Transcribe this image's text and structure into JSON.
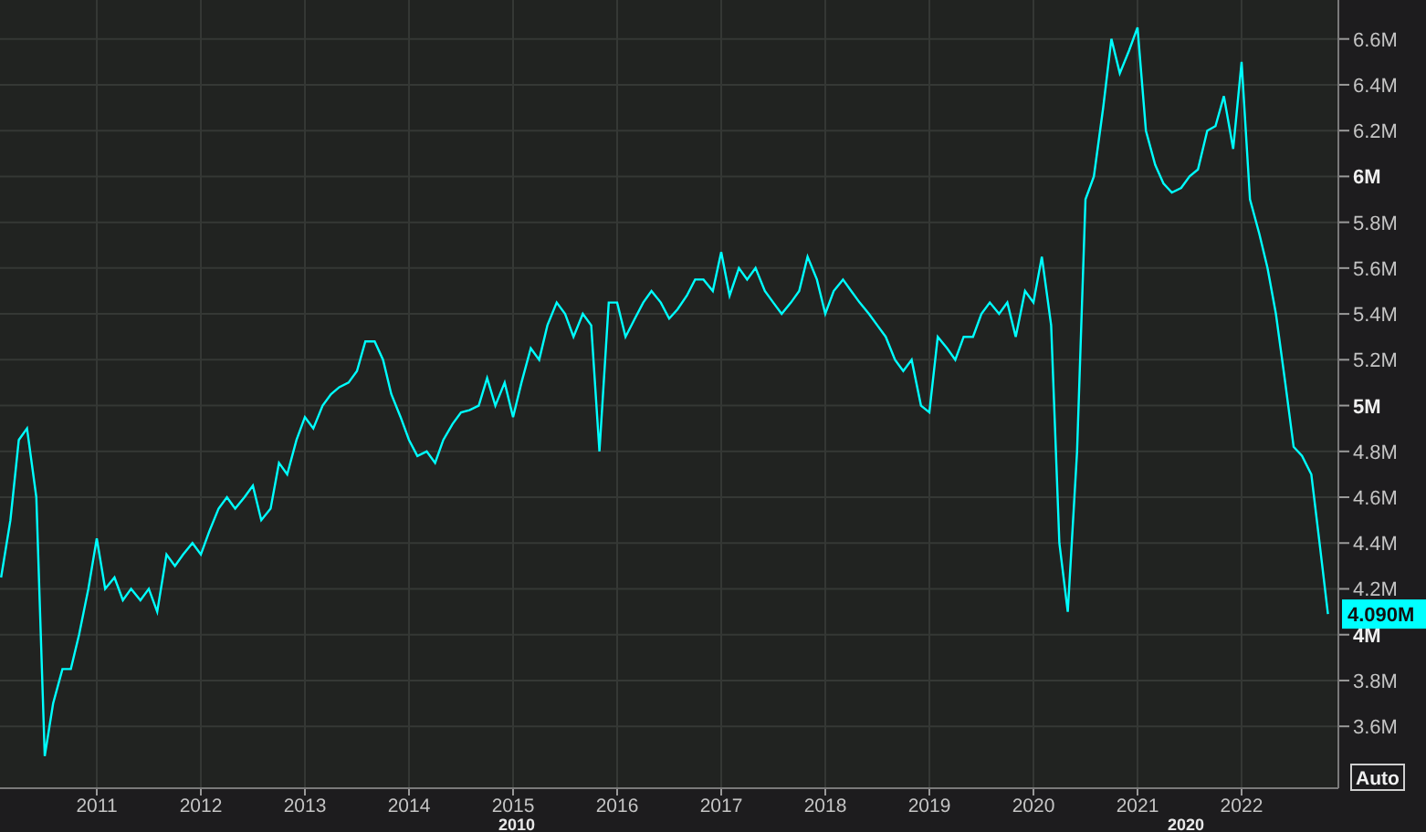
{
  "chart": {
    "chart_data": {
      "type": "line",
      "x": [
        2010.08,
        2010.17,
        2010.25,
        2010.33,
        2010.42,
        2010.5,
        2010.58,
        2010.67,
        2010.75,
        2010.83,
        2010.92,
        2011.0,
        2011.08,
        2011.17,
        2011.25,
        2011.33,
        2011.42,
        2011.5,
        2011.58,
        2011.67,
        2011.75,
        2011.83,
        2011.92,
        2012.0,
        2012.08,
        2012.17,
        2012.25,
        2012.33,
        2012.42,
        2012.5,
        2012.58,
        2012.67,
        2012.75,
        2012.83,
        2012.92,
        2013.0,
        2013.08,
        2013.17,
        2013.25,
        2013.33,
        2013.42,
        2013.5,
        2013.58,
        2013.67,
        2013.75,
        2013.83,
        2013.92,
        2014.0,
        2014.08,
        2014.17,
        2014.25,
        2014.33,
        2014.42,
        2014.5,
        2014.58,
        2014.67,
        2014.75,
        2014.83,
        2014.92,
        2015.0,
        2015.08,
        2015.17,
        2015.25,
        2015.33,
        2015.42,
        2015.5,
        2015.58,
        2015.67,
        2015.75,
        2015.83,
        2015.92,
        2016.0,
        2016.08,
        2016.17,
        2016.25,
        2016.33,
        2016.42,
        2016.5,
        2016.58,
        2016.67,
        2016.75,
        2016.83,
        2016.92,
        2017.0,
        2017.08,
        2017.17,
        2017.25,
        2017.33,
        2017.42,
        2017.5,
        2017.58,
        2017.67,
        2017.75,
        2017.83,
        2017.92,
        2018.0,
        2018.08,
        2018.17,
        2018.25,
        2018.33,
        2018.42,
        2018.5,
        2018.58,
        2018.67,
        2018.75,
        2018.83,
        2018.92,
        2019.0,
        2019.08,
        2019.17,
        2019.25,
        2019.33,
        2019.42,
        2019.5,
        2019.58,
        2019.67,
        2019.75,
        2019.83,
        2019.92,
        2020.0,
        2020.08,
        2020.17,
        2020.25,
        2020.33,
        2020.42,
        2020.5,
        2020.58,
        2020.67,
        2020.75,
        2020.83,
        2020.92,
        2021.0,
        2021.08,
        2021.17,
        2021.25,
        2021.33,
        2021.42,
        2021.5,
        2021.58,
        2021.67,
        2021.75,
        2021.83,
        2021.92,
        2022.0,
        2022.08,
        2022.17,
        2022.25,
        2022.33,
        2022.42,
        2022.5,
        2022.58,
        2022.67,
        2022.75,
        2022.83
      ],
      "series": [
        {
          "color": "#00ffff",
          "values": [
            4.25,
            4.5,
            4.85,
            4.9,
            4.6,
            3.47,
            3.7,
            3.85,
            3.85,
            4.0,
            4.2,
            4.42,
            4.2,
            4.25,
            4.15,
            4.2,
            4.15,
            4.2,
            4.1,
            4.35,
            4.3,
            4.35,
            4.4,
            4.35,
            4.45,
            4.55,
            4.6,
            4.55,
            4.6,
            4.65,
            4.5,
            4.55,
            4.75,
            4.7,
            4.85,
            4.95,
            4.9,
            5.0,
            5.05,
            5.08,
            5.1,
            5.15,
            5.28,
            5.28,
            5.2,
            5.05,
            4.95,
            4.85,
            4.78,
            4.8,
            4.75,
            4.85,
            4.92,
            4.97,
            4.98,
            5.0,
            5.12,
            5.0,
            5.1,
            4.95,
            5.1,
            5.25,
            5.2,
            5.35,
            5.45,
            5.4,
            5.3,
            5.4,
            5.35,
            4.8,
            5.45,
            5.45,
            5.3,
            5.38,
            5.45,
            5.5,
            5.45,
            5.38,
            5.42,
            5.48,
            5.55,
            5.55,
            5.5,
            5.67,
            5.48,
            5.6,
            5.55,
            5.6,
            5.5,
            5.45,
            5.4,
            5.45,
            5.5,
            5.65,
            5.55,
            5.4,
            5.5,
            5.55,
            5.5,
            5.45,
            5.4,
            5.35,
            5.3,
            5.2,
            5.15,
            5.2,
            5.0,
            4.97,
            5.3,
            5.25,
            5.2,
            5.3,
            5.3,
            5.4,
            5.45,
            5.4,
            5.45,
            5.3,
            5.5,
            5.45,
            5.65,
            5.35,
            4.4,
            4.1,
            4.8,
            5.9,
            6.0,
            6.3,
            6.6,
            6.45,
            6.55,
            6.65,
            6.2,
            6.05,
            5.97,
            5.93,
            5.95,
            6.0,
            6.03,
            6.2,
            6.22,
            6.35,
            6.12,
            6.5,
            5.9,
            5.75,
            5.6,
            5.4,
            5.1,
            4.82,
            4.78,
            4.7,
            4.4,
            4.09
          ]
        }
      ],
      "xlim": [
        2010.07,
        2022.93
      ],
      "ylim": [
        3.33,
        6.77
      ],
      "grid": true,
      "xticks": [
        2011,
        2012,
        2013,
        2014,
        2015,
        2016,
        2017,
        2018,
        2019,
        2020,
        2021,
        2022
      ],
      "yticks": [
        {
          "value": 6.6,
          "label": "6.6M"
        },
        {
          "value": 6.4,
          "label": "6.4M"
        },
        {
          "value": 6.2,
          "label": "6.2M"
        },
        {
          "value": 6.0,
          "label": "6M"
        },
        {
          "value": 5.8,
          "label": "5.8M"
        },
        {
          "value": 5.6,
          "label": "5.6M"
        },
        {
          "value": 5.4,
          "label": "5.4M"
        },
        {
          "value": 5.2,
          "label": "5.2M"
        },
        {
          "value": 5.0,
          "label": "5M"
        },
        {
          "value": 4.8,
          "label": "4.8M"
        },
        {
          "value": 4.6,
          "label": "4.6M"
        },
        {
          "value": 4.4,
          "label": "4.4M"
        },
        {
          "value": 4.2,
          "label": "4.2M"
        },
        {
          "value": 4.0,
          "label": "4M"
        },
        {
          "value": 3.8,
          "label": "3.8M"
        },
        {
          "value": 3.6,
          "label": "3.6M"
        }
      ]
    },
    "last_value": {
      "label": "4.090M"
    },
    "auto_button": {
      "label": "Auto"
    },
    "decade_labels": [
      {
        "label": "2010"
      },
      {
        "label": "2020"
      }
    ]
  }
}
